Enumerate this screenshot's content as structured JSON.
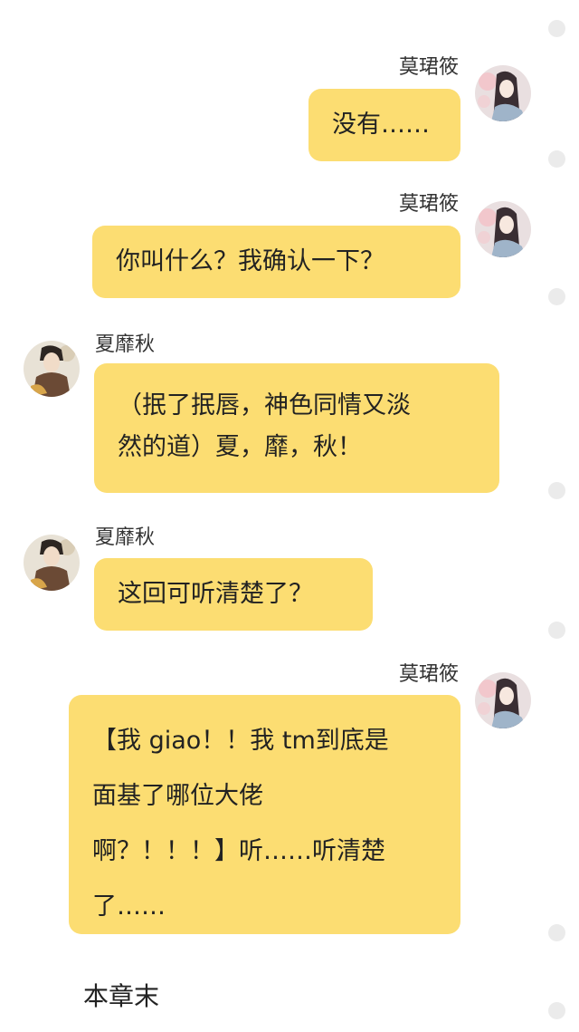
{
  "messages": [
    {
      "sender": "莫珺筱",
      "side": "right",
      "text": "没有……"
    },
    {
      "sender": "莫珺筱",
      "side": "right",
      "text": "你叫什么？我确认一下？"
    },
    {
      "sender": "夏靡秋",
      "side": "left",
      "text": "（抿了抿唇，神色同情又淡\n然的道）夏，靡，秋！"
    },
    {
      "sender": "夏靡秋",
      "side": "left",
      "text": "这回可听清楚了？"
    },
    {
      "sender": "莫珺筱",
      "side": "right",
      "text": "【我 giao！！我 tm到底是\n面基了哪位大佬\n啊？！！！】听……听清楚\n了……"
    }
  ],
  "footer": {
    "end_label": "本章末"
  },
  "colors": {
    "bubble": "#fcdd72",
    "dot": "#ebebeb",
    "background": "#ffffff"
  }
}
